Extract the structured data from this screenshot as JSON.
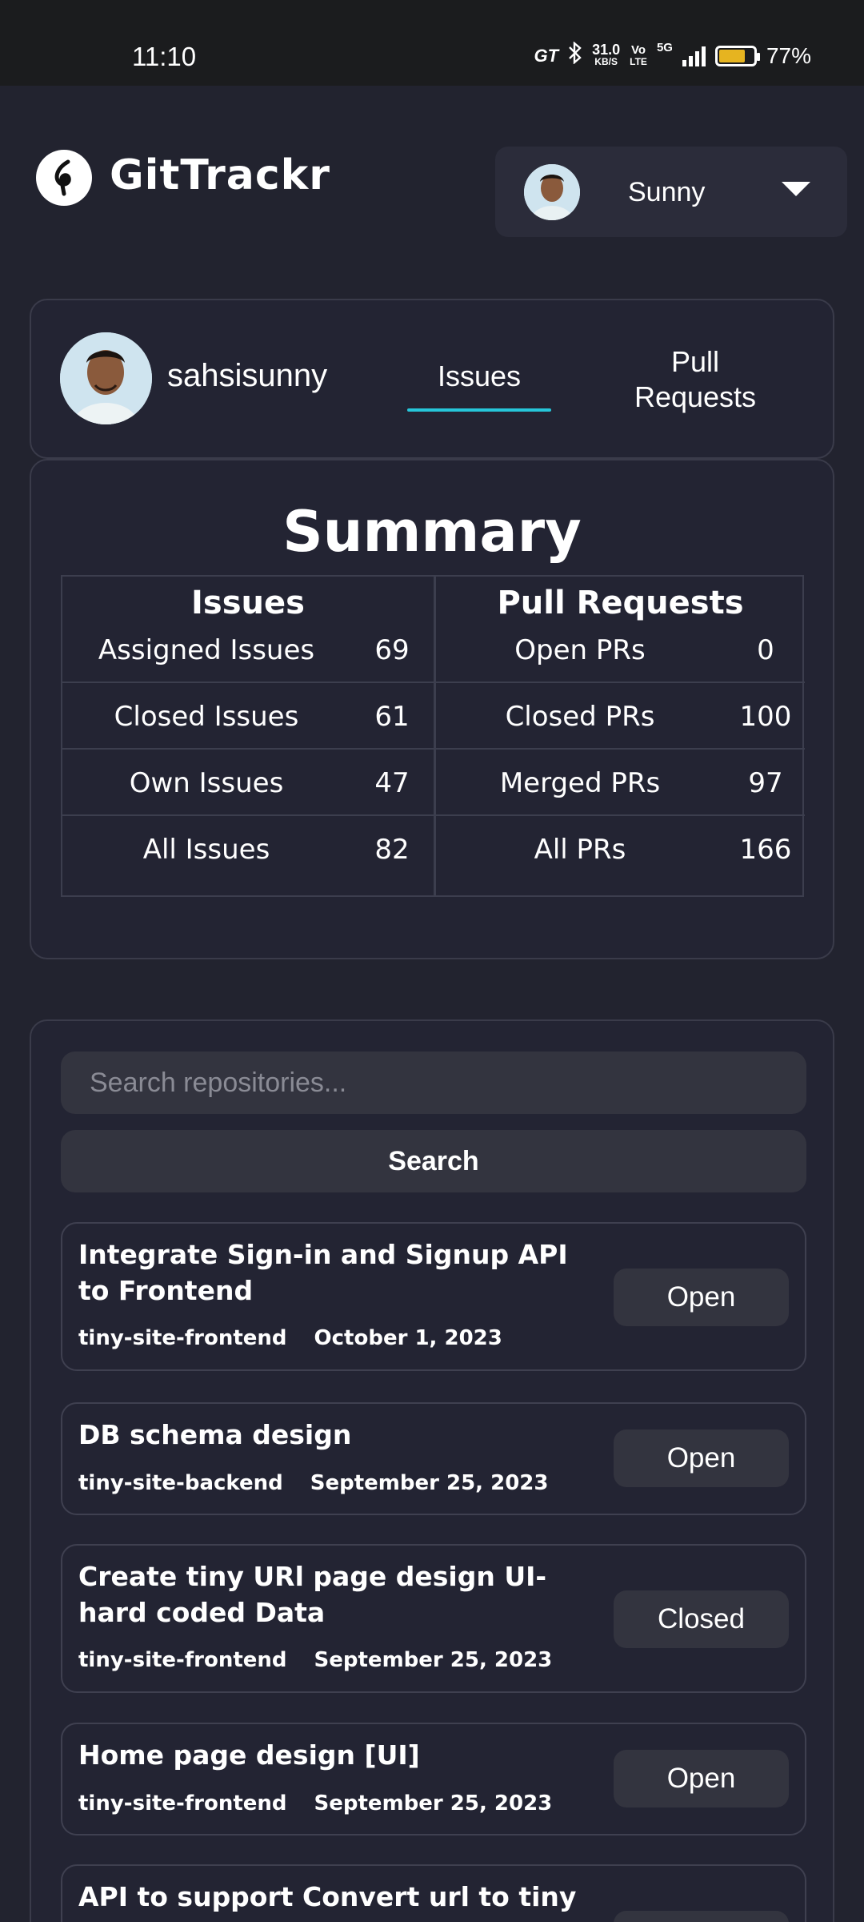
{
  "status_bar": {
    "time": "11:10",
    "brand": "GT",
    "net_speed_value": "31.0",
    "net_speed_unit": "KB/S",
    "volte_top": "Vo",
    "volte_bottom": "LTE",
    "network": "5G",
    "battery_percent": "77%",
    "battery_level": 0.77
  },
  "header": {
    "app_title": "GitTrackr",
    "user_name": "Sunny"
  },
  "profile": {
    "login": "sahsisunny",
    "tabs": [
      {
        "label": "Issues",
        "active": true
      },
      {
        "label": "Pull Requests",
        "active": false
      }
    ]
  },
  "summary": {
    "title": "Summary",
    "issues": {
      "heading": "Issues",
      "rows": [
        {
          "label": "Assigned Issues",
          "value": "69"
        },
        {
          "label": "Closed Issues",
          "value": "61"
        },
        {
          "label": "Own Issues",
          "value": "47"
        },
        {
          "label": "All Issues",
          "value": "82"
        }
      ]
    },
    "pull_requests": {
      "heading": "Pull Requests",
      "rows": [
        {
          "label": "Open PRs",
          "value": "0"
        },
        {
          "label": "Closed PRs",
          "value": "100"
        },
        {
          "label": "Merged PRs",
          "value": "97"
        },
        {
          "label": "All PRs",
          "value": "166"
        }
      ]
    }
  },
  "search": {
    "placeholder": "Search repositories...",
    "button_label": "Search"
  },
  "issues": [
    {
      "title": "Integrate Sign-in and Signup API to Frontend",
      "repo": "tiny-site-frontend",
      "date": "October 1, 2023",
      "status": "Open"
    },
    {
      "title": "DB schema design",
      "repo": "tiny-site-backend",
      "date": "September 25, 2023",
      "status": "Open"
    },
    {
      "title": "Create tiny URl page design UI- hard coded Data",
      "repo": "tiny-site-frontend",
      "date": "September 25, 2023",
      "status": "Closed"
    },
    {
      "title": "Home page design [UI]",
      "repo": "tiny-site-frontend",
      "date": "September 25, 2023",
      "status": "Open"
    },
    {
      "title": "API to support Convert url to tiny",
      "repo": "",
      "date": "",
      "status": ""
    }
  ],
  "colors": {
    "background": "#22232f",
    "card": "#232433",
    "accent_underline": "#26c6da",
    "battery_fill": "#e6b420"
  }
}
